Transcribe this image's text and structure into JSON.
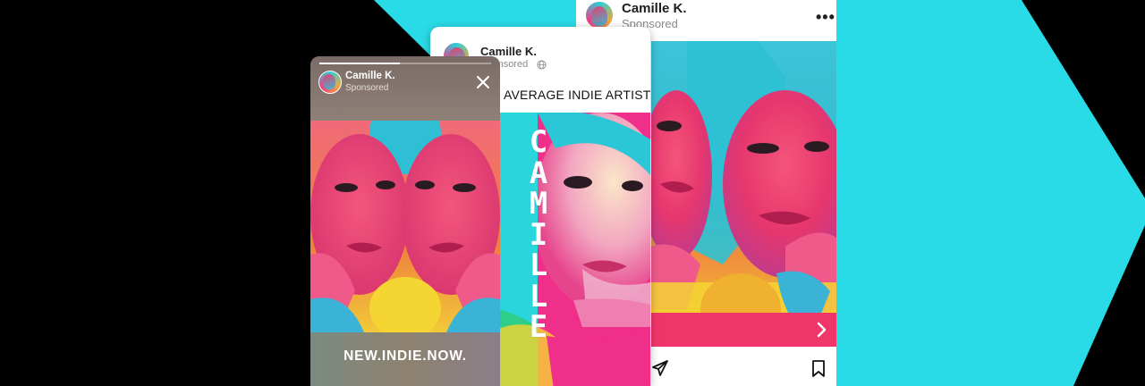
{
  "colors": {
    "cyan": "#29dbe6",
    "cta_pink": "#f0356b",
    "name_text": "#1d1d1d",
    "sub_text": "#8a8a8a"
  },
  "story_card": {
    "account_name": "Camille K.",
    "sponsored_label": "Sponsored",
    "caption": "NEW.INDIE.NOW.",
    "progress_fraction": 0.47,
    "close_icon": "close-icon"
  },
  "facebook_card": {
    "account_name": "Camille K.",
    "sponsored_label": "Sponsored",
    "visibility_icon": "globe-icon",
    "headline": "AVERAGE INDIE ARTIST",
    "vertical_word": [
      "C",
      "A",
      "M",
      "I",
      "L",
      "L",
      "E"
    ]
  },
  "feed_card": {
    "account_name": "Camille K.",
    "sponsored_label": "Sponsored",
    "more_icon": "more-dots-icon",
    "cta_icon": "chevron-right-icon",
    "share_icon": "paper-plane-icon",
    "save_icon": "bookmark-icon"
  }
}
